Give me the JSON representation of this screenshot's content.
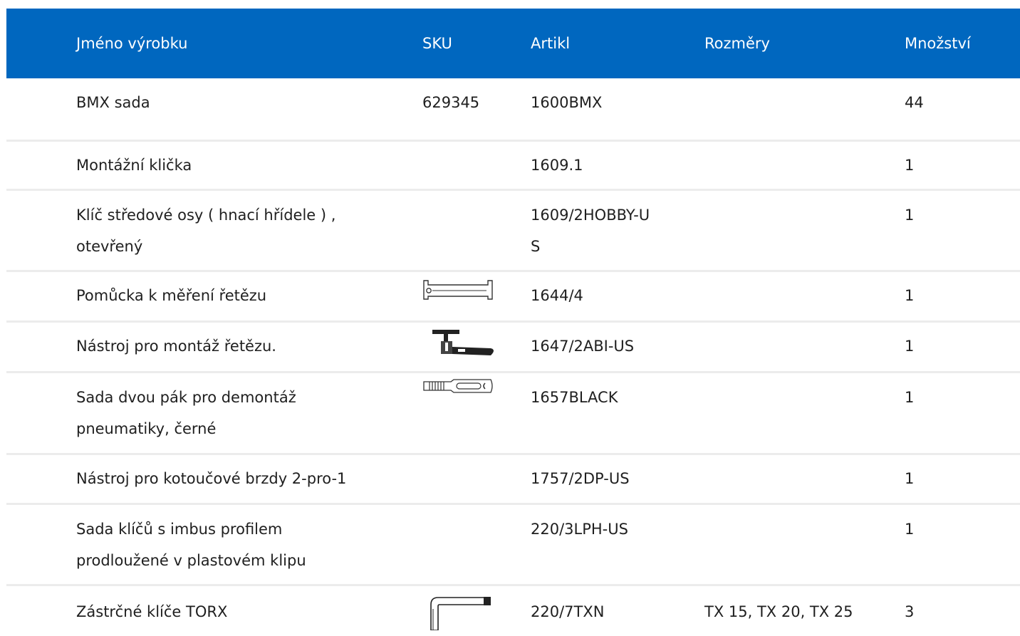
{
  "table": {
    "headers": {
      "name": "Jméno výrobku",
      "sku": "SKU",
      "article": "Artikl",
      "dimensions": "Rozměry",
      "quantity": "Množství"
    },
    "rows": [
      {
        "name": "BMX sada",
        "sku": "629345",
        "article": "1600BMX",
        "dimensions": "",
        "quantity": "44",
        "icon": ""
      },
      {
        "name": "Montážní klička",
        "sku": "",
        "article": "1609.1",
        "dimensions": "",
        "quantity": "1",
        "icon": ""
      },
      {
        "name": "Klíč středové osy ( hnací hřídele ) , otevřený",
        "sku": "",
        "article": "1609/2HOBBY-US",
        "dimensions": "",
        "quantity": "1",
        "icon": ""
      },
      {
        "name": "Pomůcka k měření řetězu",
        "sku": "",
        "article": "1644/4",
        "dimensions": "",
        "quantity": "1",
        "icon": "chain-gauge-icon"
      },
      {
        "name": "Nástroj pro montáž řetězu.",
        "sku": "",
        "article": "1647/2ABI-US",
        "dimensions": "",
        "quantity": "1",
        "icon": "chain-tool-icon"
      },
      {
        "name": "Sada dvou pák pro demontáž pneumatiky, černé",
        "sku": "",
        "article": "1657BLACK",
        "dimensions": "",
        "quantity": "1",
        "icon": "tire-lever-icon"
      },
      {
        "name": "Nástroj pro kotoučové brzdy 2-pro-1",
        "sku": "",
        "article": "1757/2DP-US",
        "dimensions": "",
        "quantity": "1",
        "icon": ""
      },
      {
        "name": "Sada klíčů s imbus profilem prodloužené v plastovém klipu",
        "sku": "",
        "article": "220/3LPH-US",
        "dimensions": "",
        "quantity": "1",
        "icon": ""
      },
      {
        "name": "Zástrčné klíče TORX",
        "sku": "",
        "article": "220/7TXN",
        "dimensions": "TX 15, TX 20, TX 25",
        "quantity": "3",
        "icon": "torx-key-icon"
      }
    ]
  }
}
